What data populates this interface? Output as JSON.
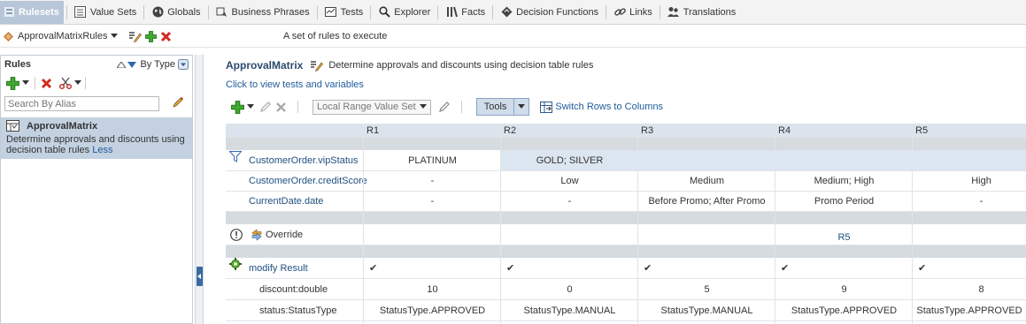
{
  "topnav": {
    "tabs": [
      {
        "label": "Rulesets",
        "icon": "rulesets-icon",
        "active": true
      },
      {
        "label": "Value Sets",
        "icon": "value-sets-icon"
      },
      {
        "label": "Globals",
        "icon": "globe-icon"
      },
      {
        "label": "Business Phrases",
        "icon": "business-phrases-icon"
      },
      {
        "label": "Tests",
        "icon": "tests-icon"
      },
      {
        "label": "Explorer",
        "icon": "search-icon"
      },
      {
        "label": "Facts",
        "icon": "facts-icon"
      },
      {
        "label": "Decision Functions",
        "icon": "decision-functions-icon"
      },
      {
        "label": "Links",
        "icon": "link-icon"
      },
      {
        "label": "Translations",
        "icon": "translations-icon"
      }
    ]
  },
  "ruleset": {
    "name": "ApprovalMatrixRules",
    "description": "A set of rules to execute"
  },
  "leftpanel": {
    "title": "Rules",
    "sort_label": "By Type",
    "search_placeholder": "Search By Alias",
    "item": {
      "title": "ApprovalMatrix",
      "description": "Determine approvals and discounts using decision table rules",
      "less_link": "Less"
    }
  },
  "main": {
    "title": "ApprovalMatrix",
    "description": "Determine approvals and discounts using decision table rules",
    "link": "Click to view tests and variables",
    "range_select": "Local Range Value Set",
    "tools_label": "Tools",
    "switch_label": "Switch Rows to Columns"
  },
  "table": {
    "rules": [
      "R1",
      "R2",
      "R3",
      "R4",
      "R5"
    ],
    "conditions": [
      {
        "label": "CustomerOrder.vipStatus",
        "values": [
          "PLATINUM",
          "GOLD; SILVER",
          "",
          "",
          ""
        ]
      },
      {
        "label": "CustomerOrder.creditScore",
        "values": [
          "-",
          "Low",
          "Medium",
          "Medium; High",
          "High"
        ]
      },
      {
        "label": "CurrentDate.date",
        "values": [
          "-",
          "-",
          "Before Promo; After Promo",
          "Promo Period",
          "-"
        ]
      }
    ],
    "conflict": {
      "label": "Override",
      "values": [
        "",
        "",
        "",
        "R5",
        ""
      ]
    },
    "action": {
      "label": "modify Result",
      "checks": [
        "✔",
        "✔",
        "✔",
        "✔",
        "✔"
      ],
      "params": [
        {
          "label": "discount:double",
          "values": [
            "10",
            "0",
            "5",
            "9",
            "8"
          ]
        },
        {
          "label": "status:StatusType",
          "values": [
            "StatusType.APPROVED",
            "StatusType.MANUAL",
            "StatusType.MANUAL",
            "StatusType.APPROVED",
            "StatusType.APPROVED"
          ]
        }
      ]
    }
  },
  "colors": {
    "accent": "#1f5c99",
    "selection": "#c3d1e1",
    "add": "#2e9a1e",
    "delete": "#d22b1f"
  }
}
